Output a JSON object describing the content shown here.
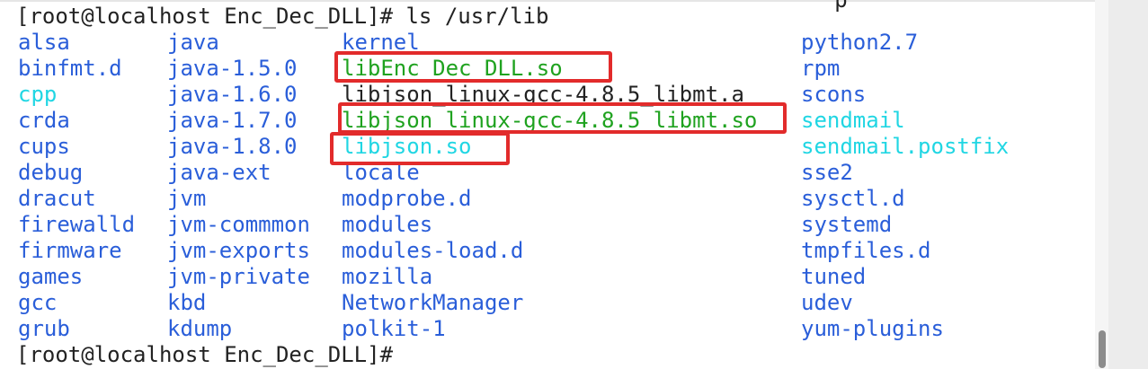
{
  "terminal": {
    "cut_previous_line": "                                                               p",
    "command_prompt": "[root@localhost Enc_Dec_DLL]# ls /usr/lib",
    "end_prompt": "[root@localhost Enc_Dec_DLL]# "
  },
  "listing": {
    "col1": [
      "alsa",
      "binfmt.d",
      "cpp",
      "crda",
      "cups",
      "debug",
      "dracut",
      "firewalld",
      "firmware",
      "games",
      "gcc",
      "grub"
    ],
    "col2": [
      "java",
      "java-1.5.0",
      "java-1.6.0",
      "java-1.7.0",
      "java-1.8.0",
      "java-ext",
      "jvm",
      "jvm-commmon",
      "jvm-exports",
      "jvm-private",
      "kbd",
      "kdump"
    ],
    "col3": [
      "kernel",
      "libEnc_Dec_DLL.so",
      "libjson_linux-gcc-4.8.5_libmt.a",
      "libjson_linux-gcc-4.8.5_libmt.so",
      "libjson.so",
      "locale",
      "modprobe.d",
      "modules",
      "modules-load.d",
      "mozilla",
      "NetworkManager",
      "polkit-1"
    ],
    "col4": [
      "python2.7",
      "rpm",
      "scons",
      "sendmail",
      "sendmail.postfix",
      "sse2",
      "sysctl.d",
      "systemd",
      "tmpfiles.d",
      "tuned",
      "udev",
      "yum-plugins"
    ]
  },
  "colors": {
    "directory": "#2a5ed9",
    "symlink": "#20d6e3",
    "executable": "#1fa21f",
    "regular": "#222222",
    "highlight_box": "#e22b2b"
  }
}
